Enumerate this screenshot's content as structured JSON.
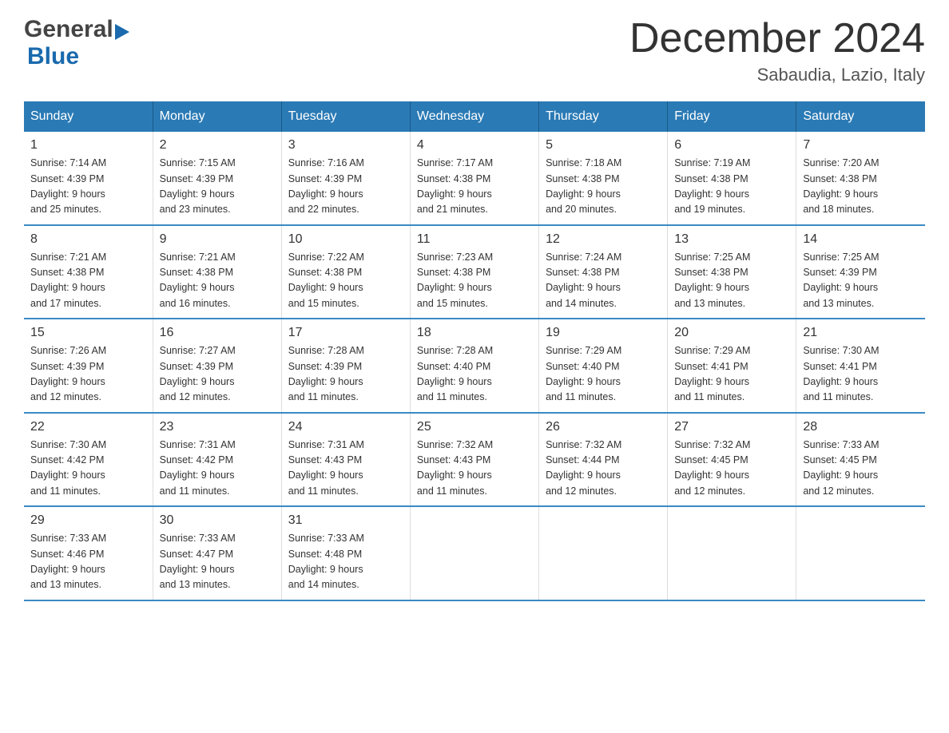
{
  "header": {
    "logo_general": "General",
    "logo_blue": "Blue",
    "month_title": "December 2024",
    "location": "Sabaudia, Lazio, Italy"
  },
  "days_of_week": [
    "Sunday",
    "Monday",
    "Tuesday",
    "Wednesday",
    "Thursday",
    "Friday",
    "Saturday"
  ],
  "weeks": [
    [
      {
        "day": "1",
        "sunrise": "7:14 AM",
        "sunset": "4:39 PM",
        "daylight": "9 hours and 25 minutes."
      },
      {
        "day": "2",
        "sunrise": "7:15 AM",
        "sunset": "4:39 PM",
        "daylight": "9 hours and 23 minutes."
      },
      {
        "day": "3",
        "sunrise": "7:16 AM",
        "sunset": "4:39 PM",
        "daylight": "9 hours and 22 minutes."
      },
      {
        "day": "4",
        "sunrise": "7:17 AM",
        "sunset": "4:38 PM",
        "daylight": "9 hours and 21 minutes."
      },
      {
        "day": "5",
        "sunrise": "7:18 AM",
        "sunset": "4:38 PM",
        "daylight": "9 hours and 20 minutes."
      },
      {
        "day": "6",
        "sunrise": "7:19 AM",
        "sunset": "4:38 PM",
        "daylight": "9 hours and 19 minutes."
      },
      {
        "day": "7",
        "sunrise": "7:20 AM",
        "sunset": "4:38 PM",
        "daylight": "9 hours and 18 minutes."
      }
    ],
    [
      {
        "day": "8",
        "sunrise": "7:21 AM",
        "sunset": "4:38 PM",
        "daylight": "9 hours and 17 minutes."
      },
      {
        "day": "9",
        "sunrise": "7:21 AM",
        "sunset": "4:38 PM",
        "daylight": "9 hours and 16 minutes."
      },
      {
        "day": "10",
        "sunrise": "7:22 AM",
        "sunset": "4:38 PM",
        "daylight": "9 hours and 15 minutes."
      },
      {
        "day": "11",
        "sunrise": "7:23 AM",
        "sunset": "4:38 PM",
        "daylight": "9 hours and 15 minutes."
      },
      {
        "day": "12",
        "sunrise": "7:24 AM",
        "sunset": "4:38 PM",
        "daylight": "9 hours and 14 minutes."
      },
      {
        "day": "13",
        "sunrise": "7:25 AM",
        "sunset": "4:38 PM",
        "daylight": "9 hours and 13 minutes."
      },
      {
        "day": "14",
        "sunrise": "7:25 AM",
        "sunset": "4:39 PM",
        "daylight": "9 hours and 13 minutes."
      }
    ],
    [
      {
        "day": "15",
        "sunrise": "7:26 AM",
        "sunset": "4:39 PM",
        "daylight": "9 hours and 12 minutes."
      },
      {
        "day": "16",
        "sunrise": "7:27 AM",
        "sunset": "4:39 PM",
        "daylight": "9 hours and 12 minutes."
      },
      {
        "day": "17",
        "sunrise": "7:28 AM",
        "sunset": "4:39 PM",
        "daylight": "9 hours and 11 minutes."
      },
      {
        "day": "18",
        "sunrise": "7:28 AM",
        "sunset": "4:40 PM",
        "daylight": "9 hours and 11 minutes."
      },
      {
        "day": "19",
        "sunrise": "7:29 AM",
        "sunset": "4:40 PM",
        "daylight": "9 hours and 11 minutes."
      },
      {
        "day": "20",
        "sunrise": "7:29 AM",
        "sunset": "4:41 PM",
        "daylight": "9 hours and 11 minutes."
      },
      {
        "day": "21",
        "sunrise": "7:30 AM",
        "sunset": "4:41 PM",
        "daylight": "9 hours and 11 minutes."
      }
    ],
    [
      {
        "day": "22",
        "sunrise": "7:30 AM",
        "sunset": "4:42 PM",
        "daylight": "9 hours and 11 minutes."
      },
      {
        "day": "23",
        "sunrise": "7:31 AM",
        "sunset": "4:42 PM",
        "daylight": "9 hours and 11 minutes."
      },
      {
        "day": "24",
        "sunrise": "7:31 AM",
        "sunset": "4:43 PM",
        "daylight": "9 hours and 11 minutes."
      },
      {
        "day": "25",
        "sunrise": "7:32 AM",
        "sunset": "4:43 PM",
        "daylight": "9 hours and 11 minutes."
      },
      {
        "day": "26",
        "sunrise": "7:32 AM",
        "sunset": "4:44 PM",
        "daylight": "9 hours and 12 minutes."
      },
      {
        "day": "27",
        "sunrise": "7:32 AM",
        "sunset": "4:45 PM",
        "daylight": "9 hours and 12 minutes."
      },
      {
        "day": "28",
        "sunrise": "7:33 AM",
        "sunset": "4:45 PM",
        "daylight": "9 hours and 12 minutes."
      }
    ],
    [
      {
        "day": "29",
        "sunrise": "7:33 AM",
        "sunset": "4:46 PM",
        "daylight": "9 hours and 13 minutes."
      },
      {
        "day": "30",
        "sunrise": "7:33 AM",
        "sunset": "4:47 PM",
        "daylight": "9 hours and 13 minutes."
      },
      {
        "day": "31",
        "sunrise": "7:33 AM",
        "sunset": "4:48 PM",
        "daylight": "9 hours and 14 minutes."
      },
      null,
      null,
      null,
      null
    ]
  ],
  "labels": {
    "sunrise": "Sunrise:",
    "sunset": "Sunset:",
    "daylight": "Daylight:"
  }
}
